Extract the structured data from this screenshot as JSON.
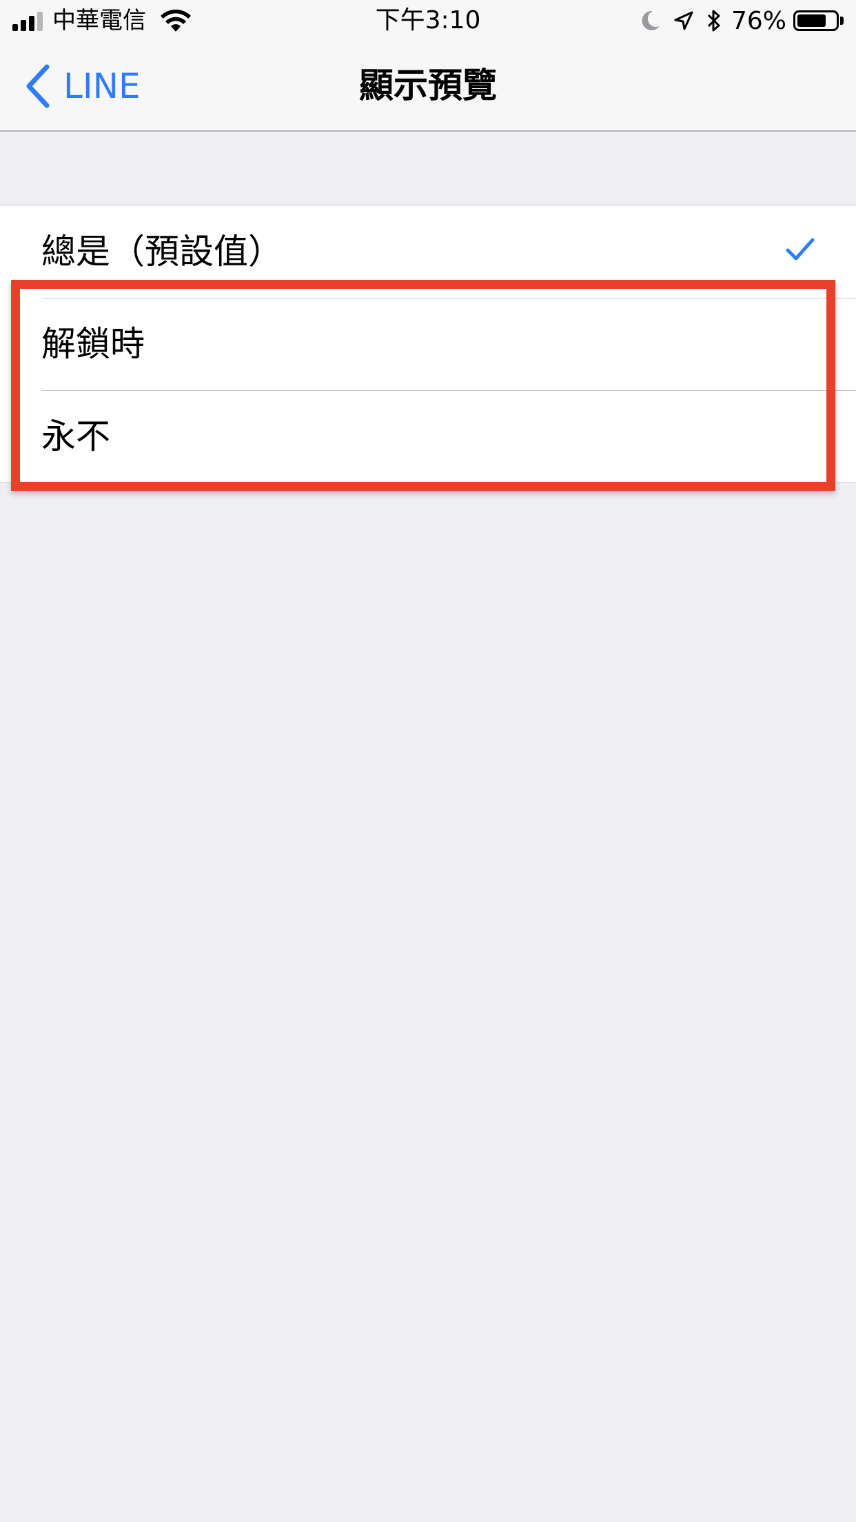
{
  "status_bar": {
    "carrier": "中華電信",
    "time": "下午3:10",
    "battery_percent": "76%",
    "battery_level": 0.76,
    "signal_bars_active": 3,
    "signal_bars_total": 4,
    "icons": [
      "signal-icon",
      "wifi-icon",
      "moon-icon",
      "location-icon",
      "bluetooth-icon",
      "battery-icon"
    ]
  },
  "nav": {
    "back_label": "LINE",
    "title": "顯示預覽"
  },
  "options": [
    {
      "label": "總是（預設值）",
      "selected": true
    },
    {
      "label": "解鎖時",
      "selected": false
    },
    {
      "label": "永不",
      "selected": false
    }
  ],
  "colors": {
    "accent": "#2f7cf6",
    "highlight": "#e8402a",
    "background": "#efeff4"
  }
}
